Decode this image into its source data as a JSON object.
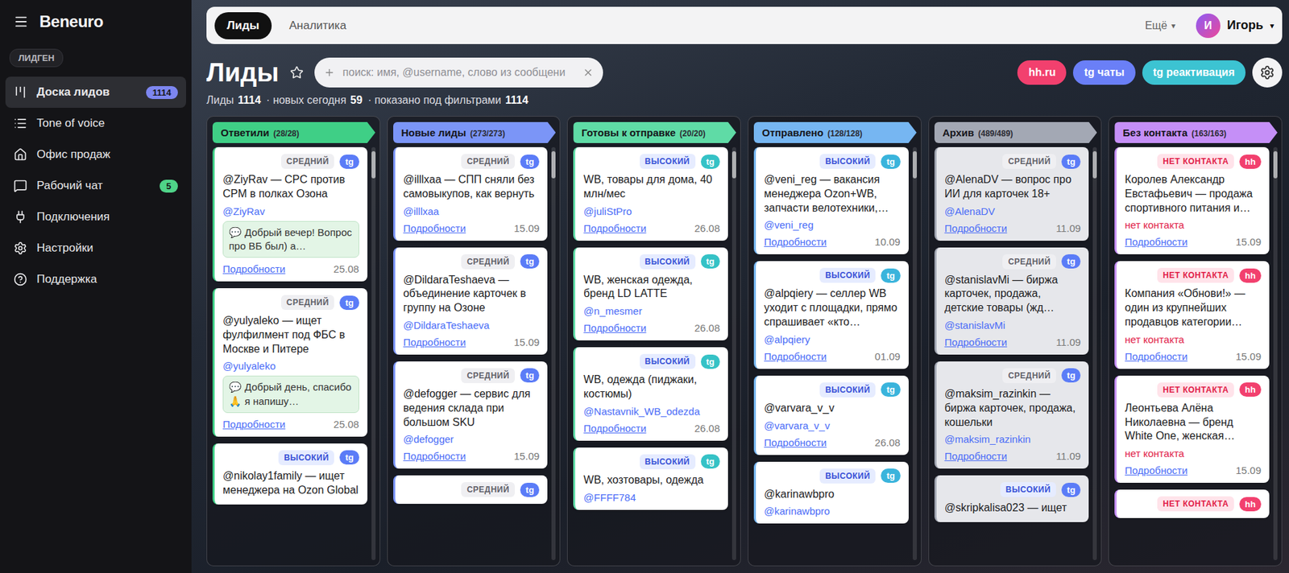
{
  "app": {
    "logo": "Beneuro"
  },
  "sidebar": {
    "section": "ЛИДГЕН",
    "items": [
      {
        "label": "Доска лидов",
        "badge": "1114",
        "badgeColor": "#7d86f0",
        "selected": true
      },
      {
        "label": "Tone of voice",
        "selected": false
      },
      {
        "label": "Офис продаж",
        "selected": false
      },
      {
        "label": "Рабочий чат",
        "badge": "5",
        "badgeColor": "#4fd388",
        "selected": false
      },
      {
        "label": "Подключения",
        "selected": false
      },
      {
        "label": "Настройки",
        "selected": false
      },
      {
        "label": "Поддержка",
        "selected": false
      }
    ]
  },
  "topbar": {
    "tabs": [
      {
        "label": "Лиды",
        "selected": true
      },
      {
        "label": "Аналитика",
        "selected": false
      }
    ],
    "more": {
      "label": "Ещё",
      "caret": "▾"
    },
    "user": {
      "initial": "И",
      "name": "Игорь",
      "caret": "▾"
    }
  },
  "page": {
    "title": "Лиды",
    "favorite": false,
    "search": {
      "placeholder": "поиск: имя, @username, слово из сообщени"
    },
    "actions": [
      {
        "label": "hh.ru",
        "color": "#f2406e"
      },
      {
        "label": "tg чаты",
        "color": "#6a7ff7"
      },
      {
        "label": "tg реактивация",
        "color": "#3cc3d2"
      }
    ],
    "stats": [
      {
        "label": "Лиды",
        "value": "1114"
      },
      {
        "label": "· новых сегодня",
        "value": "59"
      },
      {
        "label": "· показано под фильтрами",
        "value": "1114"
      }
    ]
  },
  "columns": [
    {
      "title": "Ответили",
      "count": "(28/28)",
      "color": "#3fcf86",
      "muted": false,
      "cards": [
        {
          "priority": "СРЕДНИЙ",
          "kind": "medium",
          "source": "tg",
          "sourceColor": "#5b7cf7",
          "title": "@ZiyRav — CPC против CPM в полках Озона",
          "handle": "@ZiyRav",
          "contact": true,
          "message": "💬 Добрый вечер! Вопрос про ВБ был) а…",
          "link": "Подробности",
          "date": "25.08"
        },
        {
          "priority": "СРЕДНИЙ",
          "kind": "medium",
          "source": "tg",
          "sourceColor": "#5b7cf7",
          "title": "@yulyaleko — ищет фулфилмент под ФБС в Москве и Питере",
          "handle": "@yulyaleko",
          "contact": true,
          "message": "💬 Добрый день, спасибо 🙏 я напишу…",
          "link": "Подробности",
          "date": "25.08"
        },
        {
          "priority": "ВЫСОКИЙ",
          "kind": "high",
          "source": "tg",
          "sourceColor": "#5b7cf7",
          "title": "@nikolay1family — ищет менеджера на Ozon Global",
          "contact": true
        }
      ]
    },
    {
      "title": "Новые лиды",
      "count": "(273/273)",
      "color": "#7b95f7",
      "muted": false,
      "cards": [
        {
          "priority": "СРЕДНИЙ",
          "kind": "medium",
          "source": "tg",
          "sourceColor": "#5b7cf7",
          "title": "@illlxaa — СПП сняли без самовыкупов, как вернуть",
          "handle": "@illlxaa",
          "contact": true,
          "link": "Подробности",
          "date": "15.09"
        },
        {
          "priority": "СРЕДНИЙ",
          "kind": "medium",
          "source": "tg",
          "sourceColor": "#5b7cf7",
          "title": "@DildaraTeshaeva — объединение карточек в группу на Озоне",
          "handle": "@DildaraTeshaeva",
          "contact": true,
          "link": "Подробности",
          "date": "15.09"
        },
        {
          "priority": "СРЕДНИЙ",
          "kind": "medium",
          "source": "tg",
          "sourceColor": "#5b7cf7",
          "title": "@defogger — сервис для ведения склада при большом SKU",
          "handle": "@defogger",
          "contact": true,
          "link": "Подробности",
          "date": "15.09"
        },
        {
          "priority": "СРЕДНИЙ",
          "kind": "medium",
          "source": "tg",
          "sourceColor": "#5b7cf7",
          "contact": true
        }
      ]
    },
    {
      "title": "Готовы к отправке",
      "count": "(20/20)",
      "color": "#5fdba6",
      "muted": false,
      "cards": [
        {
          "priority": "ВЫСОКИЙ",
          "kind": "high",
          "source": "tg",
          "sourceColor": "#35c2c6",
          "title": "WB, товары для дома, 40 млн/мес",
          "handle": "@juliStPro",
          "contact": true,
          "link": "Подробности",
          "date": "26.08"
        },
        {
          "priority": "ВЫСОКИЙ",
          "kind": "high",
          "source": "tg",
          "sourceColor": "#35c2c6",
          "title": "WB, женская одежда, бренд LD LATTE",
          "handle": "@n_mesmer",
          "contact": true,
          "link": "Подробности",
          "date": "26.08"
        },
        {
          "priority": "ВЫСОКИЙ",
          "kind": "high",
          "source": "tg",
          "sourceColor": "#35c2c6",
          "title": "WB, одежда (пиджаки, костюмы)",
          "handle": "@Nastavnik_WB_odezda",
          "contact": true,
          "link": "Подробности",
          "date": "26.08"
        },
        {
          "priority": "ВЫСОКИЙ",
          "kind": "high",
          "source": "tg",
          "sourceColor": "#35c2c6",
          "title": "WB, хозтовары, одежда",
          "handle": "@FFFF784",
          "contact": true
        }
      ]
    },
    {
      "title": "Отправлено",
      "count": "(128/128)",
      "color": "#76b6f2",
      "muted": false,
      "cards": [
        {
          "priority": "ВЫСОКИЙ",
          "kind": "high",
          "source": "tg",
          "sourceColor": "#3ab4dc",
          "title": "@veni_reg — вакансия менеджера Ozon+WB, запчасти велотехники,…",
          "handle": "@veni_reg",
          "contact": true,
          "link": "Подробности",
          "date": "10.09"
        },
        {
          "priority": "ВЫСОКИЙ",
          "kind": "high",
          "source": "tg",
          "sourceColor": "#3ab4dc",
          "title": "@alpqiery — селлер WB уходит с площадки, прямо спрашивает «кто…",
          "handle": "@alpqiery",
          "contact": true,
          "link": "Подробности",
          "date": "01.09"
        },
        {
          "priority": "ВЫСОКИЙ",
          "kind": "high",
          "source": "tg",
          "sourceColor": "#3ab4dc",
          "title": "@varvara_v_v",
          "handle": "@varvara_v_v",
          "contact": true,
          "link": "Подробности",
          "date": "26.08"
        },
        {
          "priority": "ВЫСОКИЙ",
          "kind": "high",
          "source": "tg",
          "sourceColor": "#3ab4dc",
          "title": "@karinawbpro",
          "handle": "@karinawbpro",
          "contact": true
        }
      ]
    },
    {
      "title": "Архив",
      "count": "(489/489)",
      "color": "#a3a8b4",
      "muted": true,
      "cards": [
        {
          "priority": "СРЕДНИЙ",
          "kind": "medium",
          "source": "tg",
          "sourceColor": "#5b7cf7",
          "title": "@AlenaDV — вопрос про ИИ для карточек 18+",
          "handle": "@AlenaDV",
          "contact": true,
          "link": "Подробности",
          "date": "11.09"
        },
        {
          "priority": "СРЕДНИЙ",
          "kind": "medium",
          "source": "tg",
          "sourceColor": "#5b7cf7",
          "title": "@stanislavMi — биржа карточек, продажа, детские товары (жд…",
          "handle": "@stanislavMi",
          "contact": true,
          "link": "Подробности",
          "date": "11.09"
        },
        {
          "priority": "СРЕДНИЙ",
          "kind": "medium",
          "source": "tg",
          "sourceColor": "#5b7cf7",
          "title": "@maksim_razinkin — биржа карточек, продажа, кошельки",
          "handle": "@maksim_razinkin",
          "contact": true,
          "link": "Подробности",
          "date": "11.09"
        },
        {
          "priority": "ВЫСОКИЙ",
          "kind": "high",
          "source": "tg",
          "sourceColor": "#5b7cf7",
          "title": "@skripkalisa023 — ищет",
          "contact": true
        }
      ]
    },
    {
      "title": "Без контакта",
      "count": "(163/163)",
      "color": "#c58ff7",
      "muted": false,
      "cards": [
        {
          "priority": "НЕТ КОНТАКТА",
          "kind": "none",
          "source": "hh",
          "sourceColor": "#f2406e",
          "title": "Королев Александр Евстафьевич — продажа спортивного питания и…",
          "handle": "нет контакта",
          "contact": false,
          "link": "Подробности",
          "date": "15.09"
        },
        {
          "priority": "НЕТ КОНТАКТА",
          "kind": "none",
          "source": "hh",
          "sourceColor": "#f2406e",
          "title": "Компания «Обнови!» — один из крупнейших продавцов категории…",
          "handle": "нет контакта",
          "contact": false,
          "link": "Подробности",
          "date": "15.09"
        },
        {
          "priority": "НЕТ КОНТАКТА",
          "kind": "none",
          "source": "hh",
          "sourceColor": "#f2406e",
          "title": "Леонтьева Алёна Николаевна — бренд White One, женская…",
          "handle": "нет контакта",
          "contact": false,
          "link": "Подробности",
          "date": "15.09"
        },
        {
          "priority": "НЕТ КОНТАКТА",
          "kind": "none",
          "source": "hh",
          "sourceColor": "#f2406e",
          "contact": false
        }
      ]
    }
  ]
}
